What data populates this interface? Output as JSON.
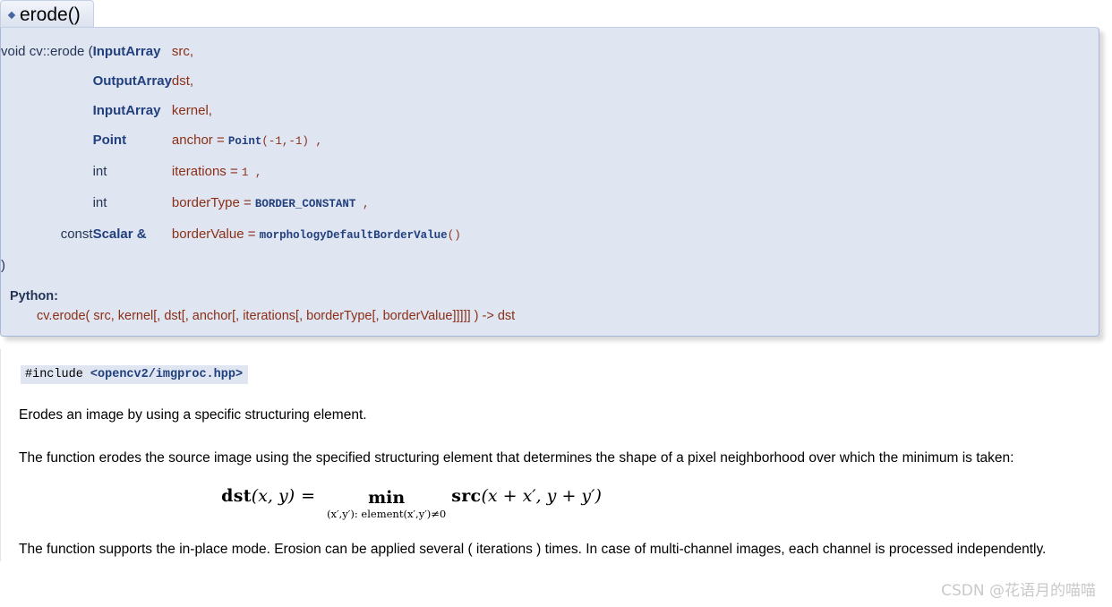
{
  "header": {
    "bullet_icon": "diamond-bullet-icon",
    "title": "erode()"
  },
  "signature": {
    "return_type": "void",
    "function_name": "cv::erode",
    "open_paren": "(",
    "close_paren": ")",
    "params": [
      {
        "key": "",
        "type": "InputArray",
        "type_kind": "link",
        "name": "src,",
        "default": ""
      },
      {
        "key": "",
        "type": "OutputArray",
        "type_kind": "link",
        "name": "dst,",
        "default": ""
      },
      {
        "key": "",
        "type": "InputArray",
        "type_kind": "link",
        "name": "kernel,",
        "default": ""
      },
      {
        "key": "",
        "type": "Point",
        "type_kind": "link",
        "name": "anchor =",
        "default_link": "Point",
        "default_rest": "(-1,-1)",
        "default_tail": ","
      },
      {
        "key": "",
        "type": "int",
        "type_kind": "plain",
        "name": "iterations =",
        "default_link": "",
        "default_rest": "1",
        "default_tail": ","
      },
      {
        "key": "",
        "type": "int",
        "type_kind": "plain",
        "name": "borderType =",
        "default_link": "BORDER_CONSTANT",
        "default_rest": "",
        "default_tail": ","
      },
      {
        "key": "const",
        "type": "Scalar",
        "type_kind": "link",
        "type_suffix": "&",
        "name": "borderValue =",
        "default_link": "morphologyDefaultBorderValue",
        "default_rest": "()",
        "default_tail": ""
      }
    ]
  },
  "python": {
    "label": "Python:",
    "signature": "cv.erode( src, kernel[, dst[, anchor[, iterations[, borderType[, borderValue]]]]] ) -> dst"
  },
  "include": {
    "directive": "#include ",
    "header": "<opencv2/imgproc.hpp>"
  },
  "body": {
    "summary": "Erodes an image by using a specific structuring element.",
    "paragraph_1": "The function erodes the source image using the specified structuring element that determines the shape of a pixel neighborhood over which the minimum is taken:",
    "paragraph_2": "The function supports the in-place mode. Erosion can be applied several ( iterations ) times. In case of multi-channel images, each channel is processed independently."
  },
  "formula": {
    "lhs_fn": "dst",
    "lhs_args": "(x, y)",
    "equals": "=",
    "operator": "min",
    "operator_subscript": "(x′,y′): element(x′,y′)≠0",
    "rhs_fn": "src",
    "rhs_args": "(x + x′, y + y′)",
    "latex": "dst(x,y) = min_{(x',y'):\\,element(x',y')\\neq 0} src(x+x', y+y')"
  },
  "watermark": {
    "text": "CSDN @花语月的喵喵"
  },
  "colors": {
    "proto_background": "#dfe5f1",
    "proto_border": "#a8b8d9",
    "type_link": "#22407e",
    "param_name": "#8b2f17",
    "text": "#000000",
    "watermark": "#c9c9c9"
  }
}
